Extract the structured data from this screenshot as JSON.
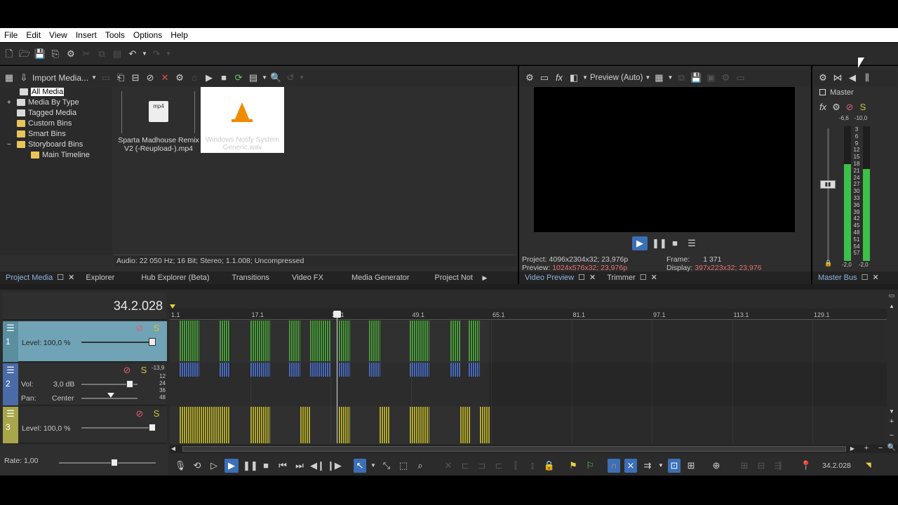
{
  "menu": [
    "File",
    "Edit",
    "View",
    "Insert",
    "Tools",
    "Options",
    "Help"
  ],
  "media_toolbar": {
    "import_label": "Import Media..."
  },
  "tree": [
    {
      "label": "All Media",
      "selected": true
    },
    {
      "label": "Media By Type",
      "expander": "+"
    },
    {
      "label": "Tagged Media"
    },
    {
      "label": "Custom Bins"
    },
    {
      "label": "Smart Bins"
    },
    {
      "label": "Storyboard Bins",
      "expander": "−"
    },
    {
      "label": "Main Timeline"
    }
  ],
  "media_items": [
    {
      "label": "Sparta Madhouse Remix V2 (-Reupload-).mp4",
      "badge": "mp4"
    },
    {
      "label": "Windows Notify System Generic.wav"
    }
  ],
  "media_status": "Audio: 22 050 Hz; 16 Bit; Stereo; 1.1.008; Uncompressed",
  "bottom_tabs_left": [
    "Project Media",
    "Explorer",
    "Hub Explorer (Beta)",
    "Transitions",
    "Video FX",
    "Media Generator",
    "Project Not"
  ],
  "preview": {
    "mode_label": "Preview (Auto)",
    "project_label": "Project:",
    "project_value": "4096x2304x32; 23,976p",
    "preview_label": "Preview:",
    "preview_value": "1024x576x32; 23,976p",
    "frame_label": "Frame:",
    "frame_value": "1 371",
    "display_label": "Display:",
    "display_value": "397x223x32; 23,976",
    "tabs": [
      "Video Preview",
      "Trimmer"
    ]
  },
  "master": {
    "title": "Master",
    "peak_left": "-6,6",
    "peak_right": "-10,0",
    "scale": [
      "3",
      "6",
      "9",
      "12",
      "15",
      "18",
      "21",
      "24",
      "27",
      "30",
      "33",
      "36",
      "39",
      "42",
      "45",
      "48",
      "51",
      "54",
      "57"
    ],
    "bottom_left": "-2,0",
    "bottom_right": "-2,0",
    "tab": "Master Bus",
    "level_left": 0.72,
    "level_right": 0.68
  },
  "timeline": {
    "time": "34.2.028",
    "ruler": [
      "1.1",
      "17.1",
      "33.1",
      "49.1",
      "65.1",
      "81.1",
      "97.1",
      "113.1",
      "129.1"
    ],
    "tracks": [
      {
        "num": "1",
        "level_label": "Level: 100,0 %"
      },
      {
        "num": "2",
        "vol_label": "Vol:",
        "vol_value": "3,0 dB",
        "pan_label": "Pan:",
        "pan_value": "Center",
        "meter_top": "-13,9",
        "meter_ticks": [
          "12",
          "24",
          "36",
          "48"
        ]
      },
      {
        "num": "3",
        "level_label": "Level: 100,0 %"
      }
    ],
    "rate_label": "Rate: 1,00",
    "end_time": "34.2.028"
  },
  "colors": {
    "video1": "#4a9a3c",
    "audio_blue": "#4a6ab8",
    "video3": "#b0a830",
    "track1_head": "#6fa3b5",
    "track2_head": "#4a6aa8",
    "track3_head": "#a8a64a"
  }
}
